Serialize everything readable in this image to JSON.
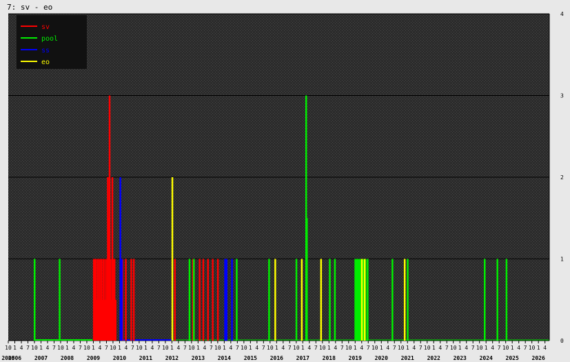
{
  "window": {
    "title": "7: sv - eo"
  },
  "chart_data": {
    "type": "bar",
    "x_axis": {
      "start": "2005-10",
      "end": "2026-06",
      "months_label": [
        "7",
        "10",
        "1",
        "4"
      ],
      "years": [
        "2005",
        "2006",
        "2007",
        "2008",
        "2009",
        "2010",
        "2011",
        "2012",
        "2013",
        "2014",
        "2015",
        "2016",
        "2017",
        "2018",
        "2019",
        "2020",
        "2021",
        "2022",
        "2023",
        "2024",
        "2025",
        "2026"
      ]
    },
    "y_axis": {
      "ylim": [
        0,
        4
      ],
      "ticks": [
        0,
        1,
        2,
        3,
        4
      ]
    },
    "grid": true,
    "legend": {
      "placement": "top-left"
    },
    "series": [
      {
        "name": "sv",
        "color": "#ff0000",
        "points": [
          [
            "2009-01-05",
            1
          ],
          [
            "2009-01-20",
            1
          ],
          [
            "2009-02-05",
            1
          ],
          [
            "2009-02-18",
            0.5
          ],
          [
            "2009-03-01",
            1
          ],
          [
            "2009-03-12",
            0.5
          ],
          [
            "2009-03-25",
            1
          ],
          [
            "2009-04-05",
            0.5
          ],
          [
            "2009-04-18",
            1
          ],
          [
            "2009-05-01",
            0.5
          ],
          [
            "2009-05-14",
            1
          ],
          [
            "2009-05-28",
            0.5
          ],
          [
            "2009-06-10",
            1
          ],
          [
            "2009-06-22",
            0.5
          ],
          [
            "2009-07-05",
            1
          ],
          [
            "2009-07-18",
            2
          ],
          [
            "2009-08-01",
            1.5
          ],
          [
            "2009-08-12",
            3
          ],
          [
            "2009-08-25",
            1
          ],
          [
            "2009-09-08",
            0.5
          ],
          [
            "2009-09-20",
            2
          ],
          [
            "2009-10-05",
            1
          ],
          [
            "2009-10-20",
            1
          ],
          [
            "2009-11-05",
            0.5
          ],
          [
            "2010-02-10",
            1
          ],
          [
            "2010-03-25",
            1
          ],
          [
            "2010-06-10",
            1
          ],
          [
            "2010-07-15",
            1
          ],
          [
            "2012-02-10",
            1
          ],
          [
            "2012-10-20",
            1
          ],
          [
            "2013-01-20",
            1
          ],
          [
            "2013-03-10",
            1
          ],
          [
            "2013-05-15",
            1
          ],
          [
            "2013-07-20",
            1
          ],
          [
            "2013-10-01",
            1
          ]
        ]
      },
      {
        "name": "pool",
        "color": "#00ee00",
        "points": [
          [
            "2006-10-01",
            1
          ],
          [
            "2007-09-15",
            1
          ],
          [
            "2012-09-01",
            1
          ],
          [
            "2012-11-01",
            1
          ],
          [
            "2014-06-20",
            1
          ],
          [
            "2015-09-15",
            1
          ],
          [
            "2016-10-01",
            1
          ],
          [
            "2017-02-15",
            3
          ],
          [
            "2017-02-25",
            1.5
          ],
          [
            "2018-01-10",
            1
          ],
          [
            "2018-03-20",
            1
          ],
          [
            "2019-01-01",
            1
          ],
          [
            "2019-01-20",
            1
          ],
          [
            "2019-02-10",
            1
          ],
          [
            "2019-03-01",
            1
          ],
          [
            "2019-03-20",
            1
          ],
          [
            "2019-04-10",
            1
          ],
          [
            "2019-05-01",
            1
          ],
          [
            "2019-05-20",
            1
          ],
          [
            "2019-06-20",
            1
          ],
          [
            "2020-06-01",
            1
          ],
          [
            "2021-01-01",
            1
          ],
          [
            "2023-12-10",
            1
          ],
          [
            "2024-06-05",
            1
          ],
          [
            "2024-10-10",
            1
          ]
        ]
      },
      {
        "name": "ss",
        "color": "#0000ff",
        "points": [
          [
            "2010-01-10",
            2
          ],
          [
            "2010-02-01",
            1
          ],
          [
            "2014-01-10",
            1
          ],
          [
            "2014-02-01",
            1
          ],
          [
            "2014-04-15",
            1
          ]
        ]
      },
      {
        "name": "eo",
        "color": "#ffff00",
        "points": [
          [
            "2012-01-05",
            2
          ],
          [
            "2015-12-10",
            1
          ],
          [
            "2016-12-15",
            1
          ],
          [
            "2017-09-10",
            1
          ],
          [
            "2019-04-01",
            1
          ],
          [
            "2019-05-10",
            1
          ],
          [
            "2020-11-20",
            1
          ]
        ]
      }
    ]
  }
}
